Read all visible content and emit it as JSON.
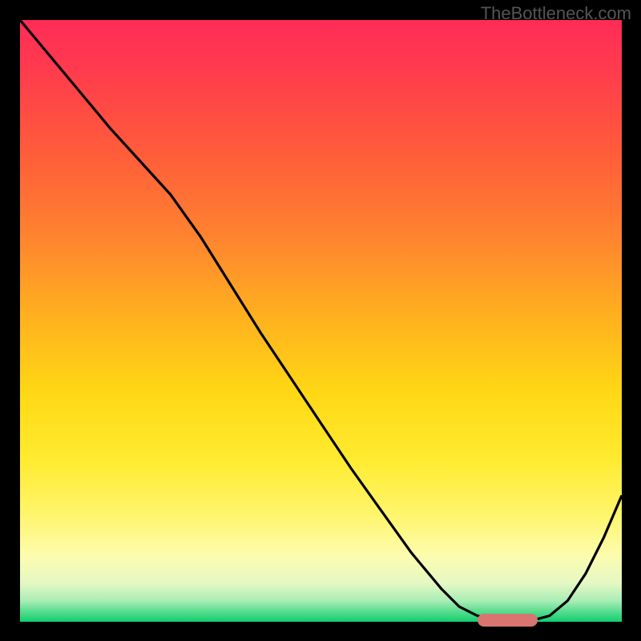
{
  "watermark": "TheBottleneck.com",
  "chart_data": {
    "type": "line",
    "title": "",
    "xlabel": "",
    "ylabel": "",
    "xlim": [
      0,
      100
    ],
    "ylim": [
      0,
      100
    ],
    "series": [
      {
        "name": "curve",
        "x": [
          0,
          5,
          10,
          15,
          20,
          25,
          30,
          35,
          40,
          45,
          50,
          55,
          60,
          65,
          70,
          73,
          76,
          79,
          82,
          85,
          88,
          91,
          94,
          97,
          100
        ],
        "y": [
          100,
          94,
          88,
          82,
          76.5,
          71,
          64,
          56,
          48,
          40.5,
          33,
          25.5,
          18.5,
          11.5,
          5.5,
          2.5,
          1,
          0.3,
          0,
          0.2,
          1,
          3.5,
          8,
          14,
          21
        ]
      }
    ],
    "gradient_stops": [
      {
        "offset": 0.0,
        "color": "#ff2b57"
      },
      {
        "offset": 0.1,
        "color": "#ff3f4b"
      },
      {
        "offset": 0.22,
        "color": "#ff5c3a"
      },
      {
        "offset": 0.35,
        "color": "#ff8030"
      },
      {
        "offset": 0.5,
        "color": "#ffb31e"
      },
      {
        "offset": 0.62,
        "color": "#ffd815"
      },
      {
        "offset": 0.73,
        "color": "#ffeb30"
      },
      {
        "offset": 0.82,
        "color": "#fff56a"
      },
      {
        "offset": 0.89,
        "color": "#fdfcae"
      },
      {
        "offset": 0.935,
        "color": "#e6f8c4"
      },
      {
        "offset": 0.965,
        "color": "#a9edb6"
      },
      {
        "offset": 0.983,
        "color": "#58dd8e"
      },
      {
        "offset": 1.0,
        "color": "#12ce6e"
      }
    ],
    "marker": {
      "x_start": 76,
      "x_end": 86,
      "y": 0.3
    }
  },
  "colors": {
    "background": "#000000",
    "line": "#000000",
    "marker": "#d97570",
    "watermark": "#555555"
  }
}
